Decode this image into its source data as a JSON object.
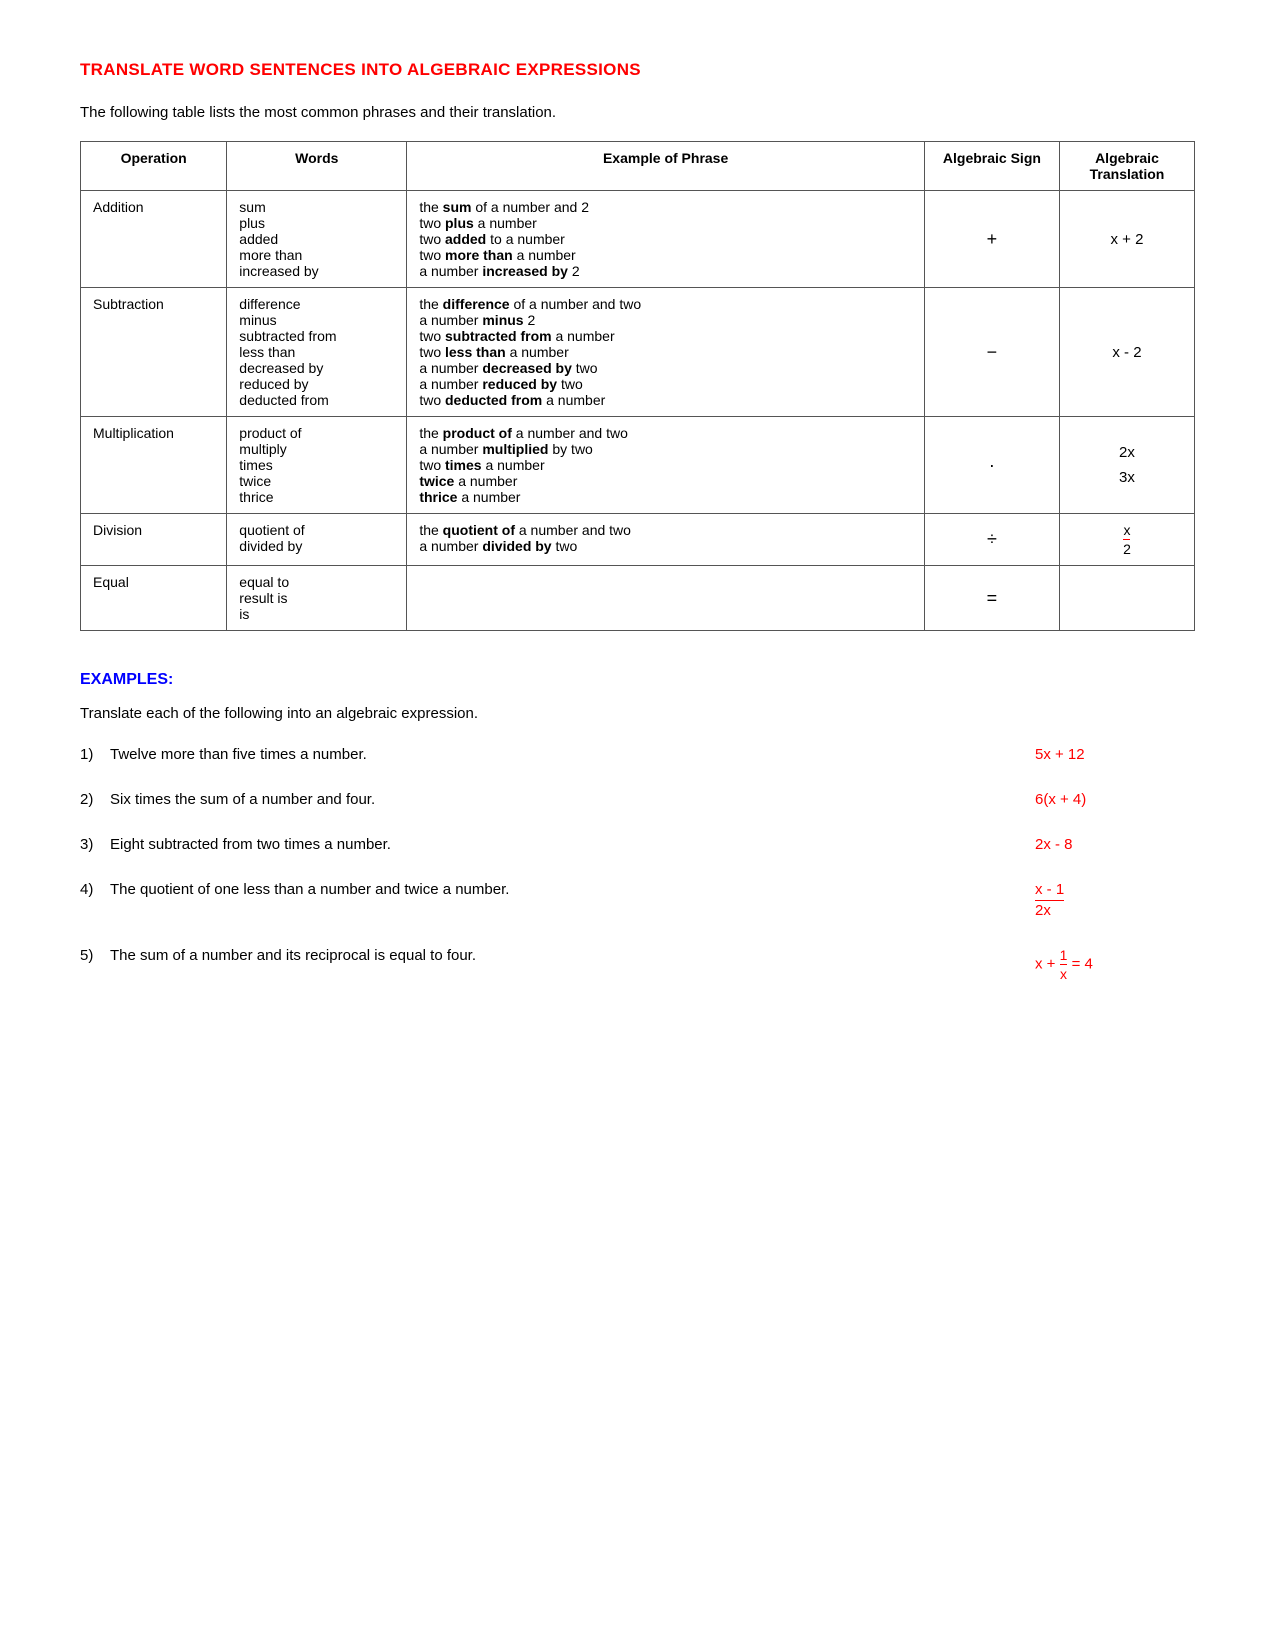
{
  "title": "TRANSLATE WORD SENTENCES INTO ALGEBRAIC EXPRESSIONS",
  "intro": "The following table lists the most common phrases and their translation.",
  "table": {
    "headers": [
      "Operation",
      "Words",
      "Example of Phrase",
      "Algebraic Sign",
      "Algebraic Translation"
    ],
    "rows": [
      {
        "operation": "Addition",
        "words": [
          "sum",
          "plus",
          "added",
          "more than",
          "increased by"
        ],
        "examples": [
          {
            "text": "the ",
            "bold": "sum",
            "rest": " of a number and 2"
          },
          {
            "text": "two ",
            "bold": "plus",
            "rest": " a number"
          },
          {
            "text": "two ",
            "bold": "added",
            "rest": " to a number"
          },
          {
            "text": "two ",
            "bold": "more than",
            "rest": " a number"
          },
          {
            "text": "a number ",
            "bold": "increased by",
            "rest": " 2"
          }
        ],
        "sign": "+",
        "translation": "x + 2"
      },
      {
        "operation": "Subtraction",
        "words": [
          "difference",
          "minus",
          "subtracted from",
          "less than",
          "decreased by",
          "reduced by",
          "deducted from"
        ],
        "examples": [
          {
            "text": "the ",
            "bold": "difference",
            "rest": " of a number and two"
          },
          {
            "text": "a number ",
            "bold": "minus",
            "rest": " 2"
          },
          {
            "text": "two ",
            "bold": "subtracted from",
            "rest": " a number"
          },
          {
            "text": "two ",
            "bold": "less than",
            "rest": " a number"
          },
          {
            "text": "a number ",
            "bold": "decreased by",
            "rest": " two"
          },
          {
            "text": "a number ",
            "bold": "reduced by",
            "rest": " two"
          },
          {
            "text": "two ",
            "bold": "deducted from",
            "rest": " a number"
          }
        ],
        "sign": "−",
        "translation": "x - 2"
      },
      {
        "operation": "Multiplication",
        "words": [
          "product of",
          "multiply",
          "times",
          "twice",
          "thrice"
        ],
        "examples": [
          {
            "text": "the ",
            "bold": "product of",
            "rest": " a number and two"
          },
          {
            "text": "a number ",
            "bold": "multiplied",
            "rest": " by two"
          },
          {
            "text": "two ",
            "bold": "times",
            "rest": " a number"
          },
          {
            "bold": "twice",
            "rest": " a number"
          },
          {
            "bold": "thrice",
            "rest": " a number"
          }
        ],
        "sign": "·",
        "translation": "2x\n3x"
      },
      {
        "operation": "Division",
        "words": [
          "quotient of",
          "divided by"
        ],
        "examples": [
          {
            "text": "the ",
            "bold": "quotient of",
            "rest": " a number and two"
          },
          {
            "text": "a number ",
            "bold": "divided by",
            "rest": " two"
          }
        ],
        "sign": "÷",
        "translation": "x/2"
      },
      {
        "operation": "Equal",
        "words": [
          "equal to",
          "result is",
          "is"
        ],
        "examples": [],
        "sign": "=",
        "translation": ""
      }
    ]
  },
  "examples_section": {
    "title": "EXAMPLES:",
    "intro": "Translate each of the following into an algebraic expression.",
    "items": [
      {
        "num": "1)",
        "text": "Twelve more than five times a number.",
        "answer": "5x + 12",
        "type": "simple"
      },
      {
        "num": "2)",
        "text": "Six times the sum of a number and four.",
        "answer": "6(x + 4)",
        "type": "simple"
      },
      {
        "num": "3)",
        "text": "Eight subtracted from two times a number.",
        "answer": "2x - 8",
        "type": "simple"
      },
      {
        "num": "4)",
        "text": "The quotient of one less than a number and twice a number.",
        "answer_num": "x - 1",
        "answer_den": "2x",
        "type": "fraction"
      },
      {
        "num": "5)",
        "text": "The sum of  a number and its reciprocal is equal to four.",
        "answer_prefix": "x + ",
        "answer_num": "1",
        "answer_den": "x",
        "answer_suffix": " = 4",
        "type": "fraction-inline"
      }
    ]
  }
}
